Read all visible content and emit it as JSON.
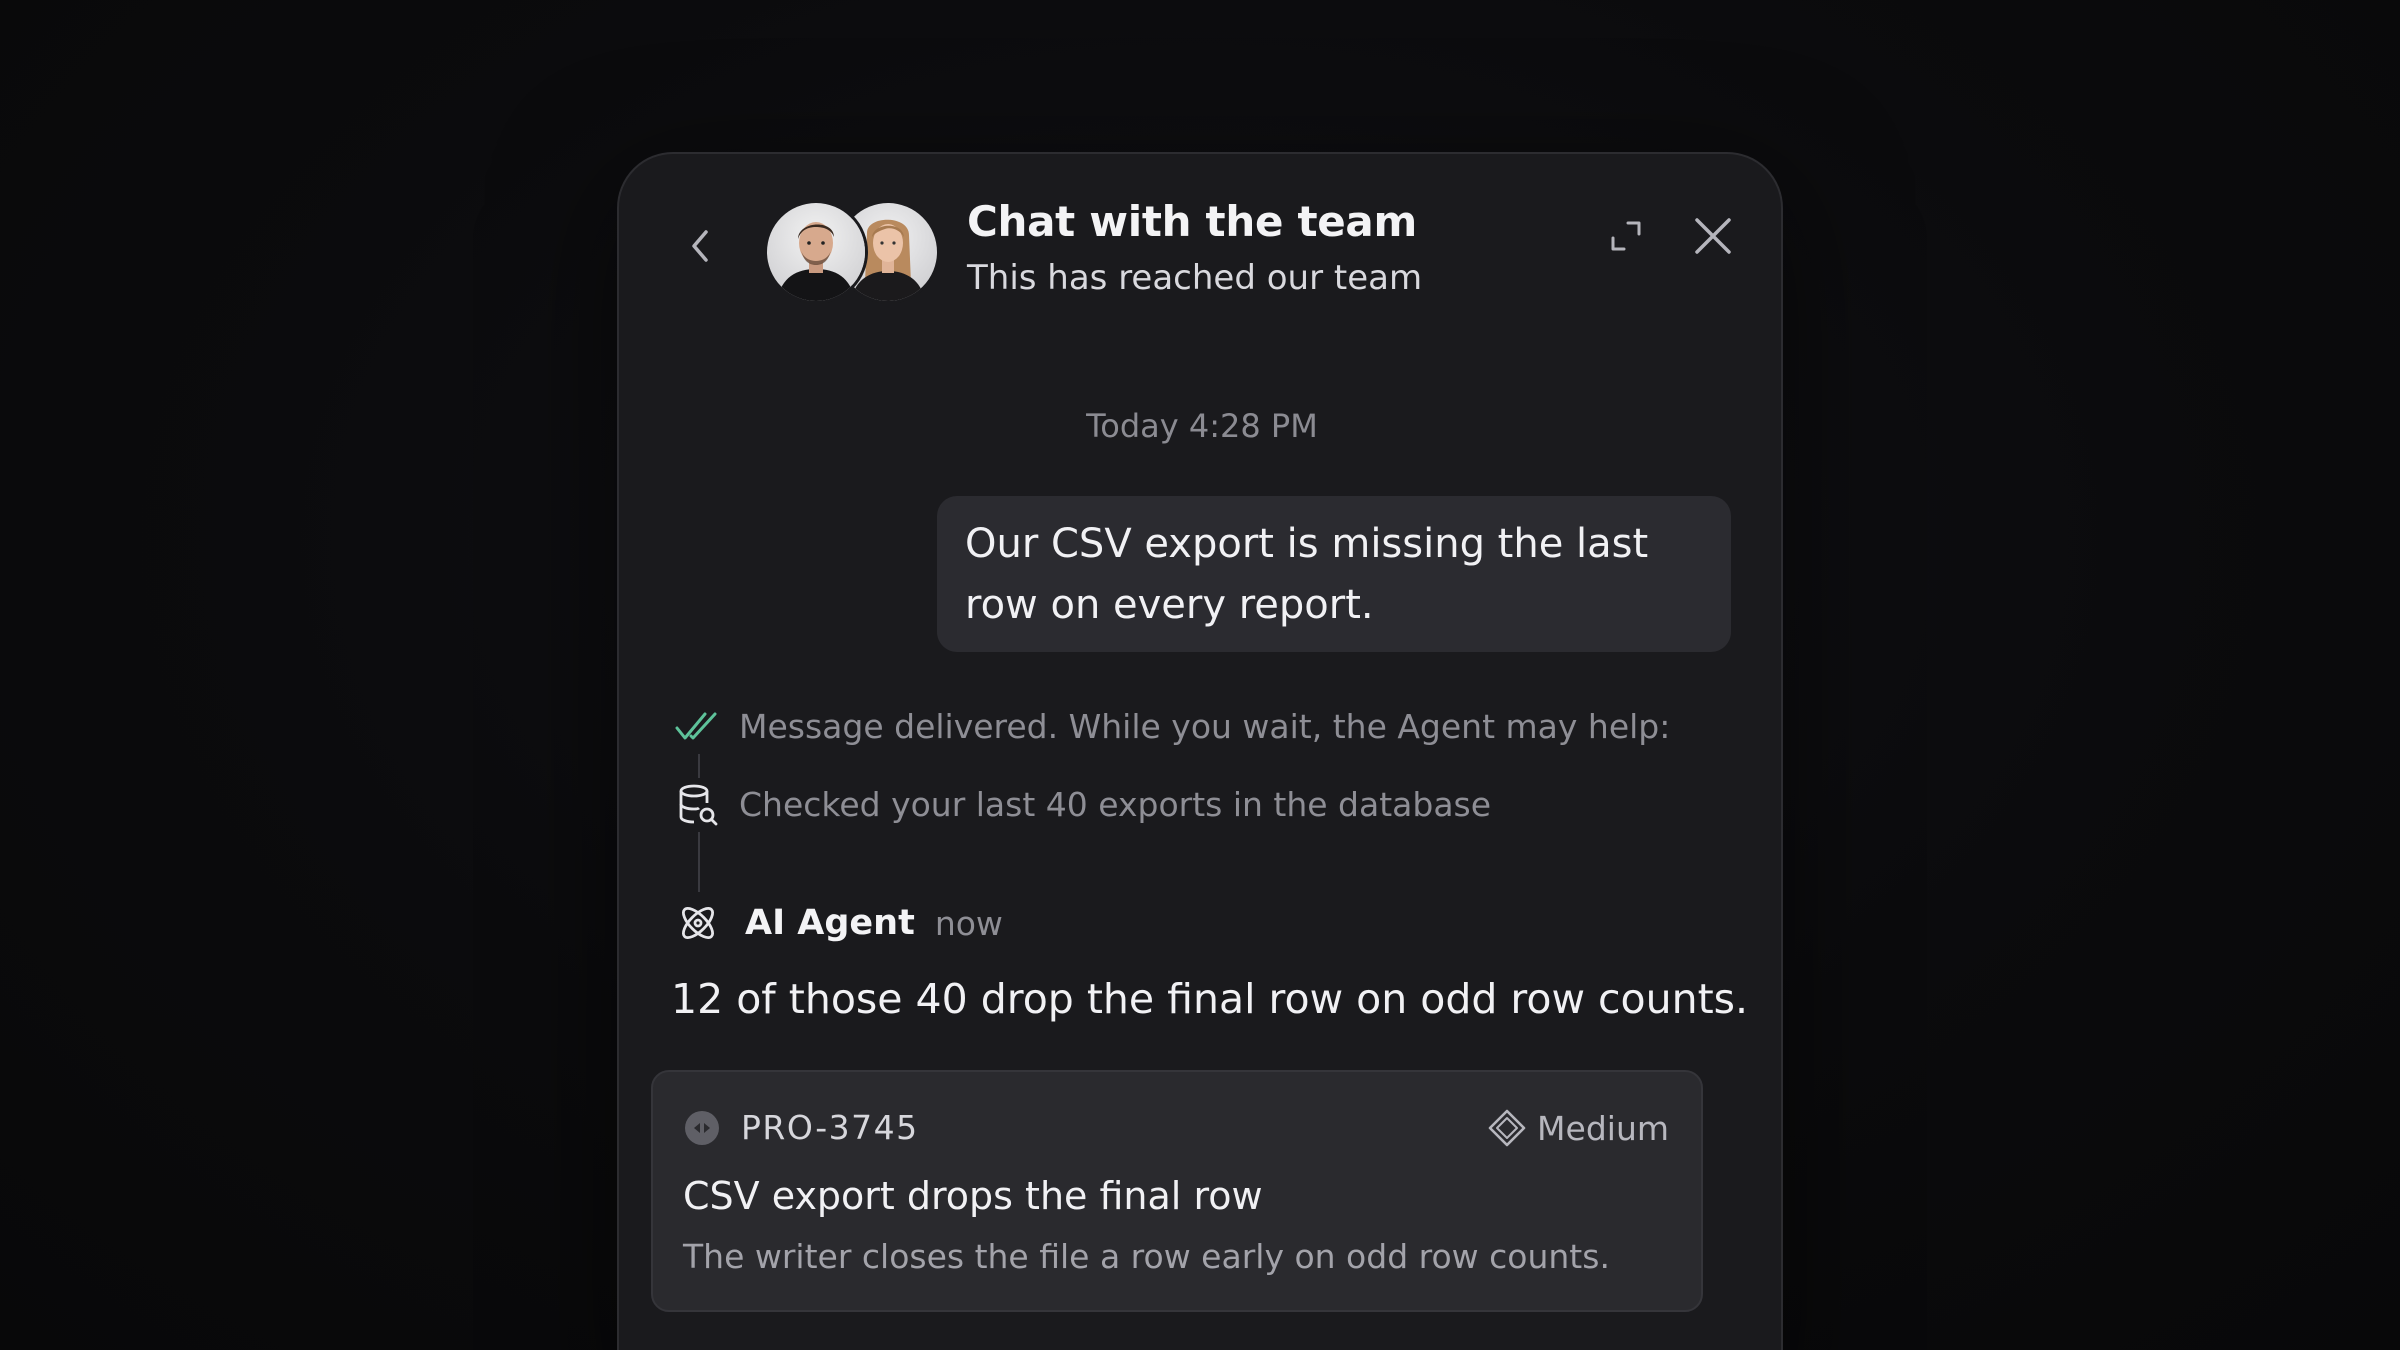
{
  "header": {
    "title": "Chat with the team",
    "subtitle": "This has reached our team",
    "back_icon": "chevron-left-icon",
    "expand_icon": "expand-icon",
    "close_icon": "close-icon",
    "avatars": [
      "team-member-1",
      "team-member-2"
    ]
  },
  "conversation": {
    "timestamp": "Today 4:28 PM",
    "user_message": "Our CSV export is missing the last row on every report.",
    "steps": [
      {
        "icon": "double-check-icon",
        "text": "Message delivered. While you wait, the Agent may help:"
      },
      {
        "icon": "database-search-icon",
        "text": "Checked your last 40 exports in the database"
      }
    ],
    "agent": {
      "icon": "ai-agent-icon",
      "name": "AI Agent",
      "time": "now",
      "message": "12 of those 40 drop the final row on odd row counts."
    }
  },
  "ticket": {
    "icon": "issue-status-icon",
    "id": "PRO-3745",
    "priority_icon": "diamond-icon",
    "priority": "Medium",
    "title": "CSV export drops the final row",
    "description": "The writer closes the file a row early on odd row counts."
  },
  "colors": {
    "background": "#0b0b0d",
    "panel": "#1a1a1d",
    "bubble": "#2b2b30",
    "card": "#2a2a2e",
    "delivered_check": "#5ec29a",
    "muted_text": "#8e8e95",
    "primary_text": "#f1f1f4"
  }
}
